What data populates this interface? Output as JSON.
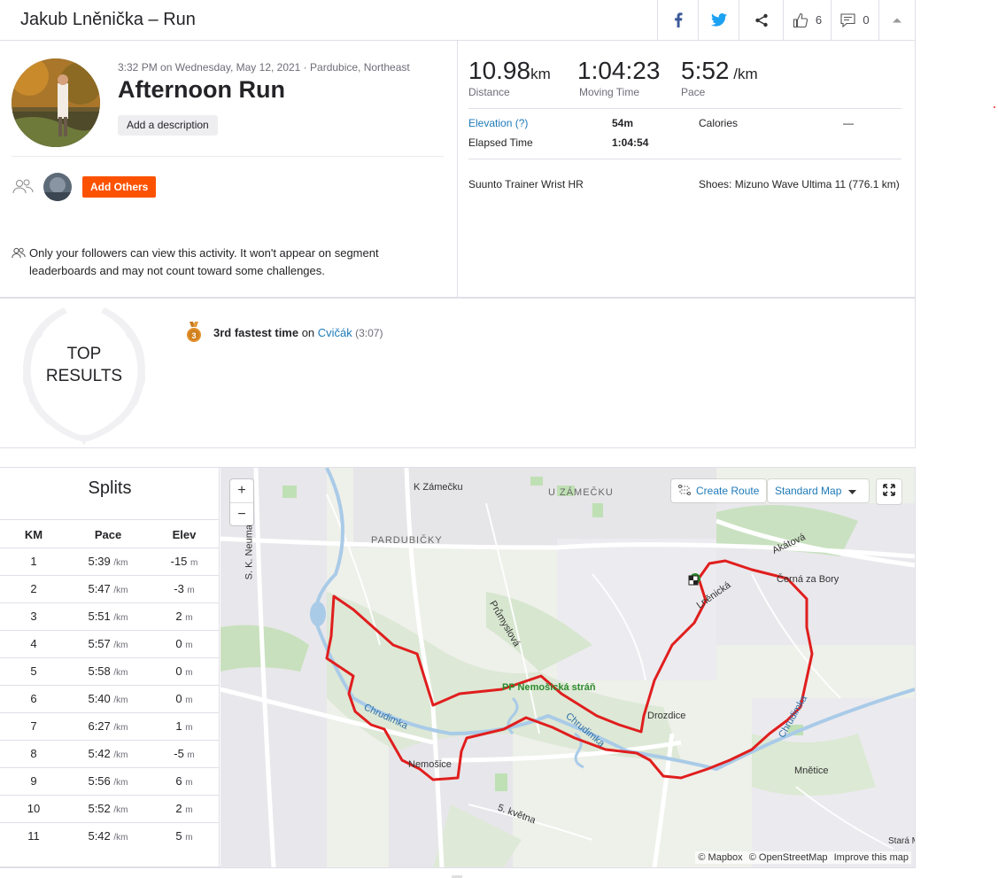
{
  "header": {
    "title": "Jakub Lněnička – Run",
    "kudos_count": "6",
    "comments_count": "0"
  },
  "activity": {
    "meta": "3:32 PM on Wednesday, May 12, 2021 · Pardubice, Northeast",
    "title": "Afternoon Run",
    "add_description": "Add a description",
    "add_others": "Add Others",
    "privacy_note": "Only your followers can view this activity. It won't appear on segment leaderboards and may not count toward some challenges."
  },
  "stats": {
    "distance": {
      "value": "10.98",
      "unit": "km",
      "label": "Distance"
    },
    "moving_time": {
      "value": "1:04:23",
      "label": "Moving Time"
    },
    "pace": {
      "value": "5:52",
      "unit": " /km",
      "label": "Pace"
    },
    "elevation_label": "Elevation (?)",
    "elevation_value": "54m",
    "calories_label": "Calories",
    "calories_value": "—",
    "elapsed_label": "Elapsed Time",
    "elapsed_value": "1:04:54",
    "device": "Suunto Trainer Wrist HR",
    "shoes": "Shoes: Mizuno Wave Ultima 11 (776.1 km)"
  },
  "top_results": {
    "heading_line1": "TOP",
    "heading_line2": "RESULTS",
    "medal_number": "3",
    "achievement_bold": "3rd fastest time",
    "achievement_on": " on ",
    "segment": "Cvičák",
    "segment_time": " (3:07)"
  },
  "splits": {
    "title": "Splits",
    "columns": [
      "KM",
      "Pace",
      "Elev"
    ],
    "pace_unit": "/km",
    "elev_unit": "m",
    "rows": [
      {
        "km": "1",
        "pace": "5:39",
        "elev": "-15"
      },
      {
        "km": "2",
        "pace": "5:47",
        "elev": "-3"
      },
      {
        "km": "3",
        "pace": "5:51",
        "elev": "2"
      },
      {
        "km": "4",
        "pace": "5:57",
        "elev": "0"
      },
      {
        "km": "5",
        "pace": "5:58",
        "elev": "0"
      },
      {
        "km": "6",
        "pace": "5:40",
        "elev": "0"
      },
      {
        "km": "7",
        "pace": "6:27",
        "elev": "1"
      },
      {
        "km": "8",
        "pace": "5:42",
        "elev": "-5"
      },
      {
        "km": "9",
        "pace": "5:56",
        "elev": "6"
      },
      {
        "km": "10",
        "pace": "5:52",
        "elev": "2"
      },
      {
        "km": "11",
        "pace": "5:42",
        "elev": "5"
      }
    ]
  },
  "map": {
    "zoom_in": "+",
    "zoom_out": "−",
    "create_route": "Create Route",
    "map_style": "Standard Map",
    "attribution_mapbox": "© Mapbox",
    "attribution_osm": "© OpenStreetMap",
    "attribution_improve": "Improve this map",
    "route_color": "#e01e1e",
    "labels": {
      "k_zamecku": "K Zámečku",
      "u_zamecku": "U ZÁMEČKU",
      "pardubicky": "PARDUBIČKY",
      "s_k_neumanna": "S. K. Neumanna",
      "akatova": "Akátová",
      "cerna_za_bory": "Černá za Bory",
      "lnenicka": "Lněnická",
      "prumyslova": "Průmyslová",
      "pp_nemosicka": "PP Nemošická stráň",
      "chrudimka": "Chrudimka",
      "drozdice": "Drozdice",
      "nemosice": "Nemošice",
      "mnetice": "Mnětice",
      "kvetna": "5. května",
      "stara": "Stará M"
    }
  }
}
